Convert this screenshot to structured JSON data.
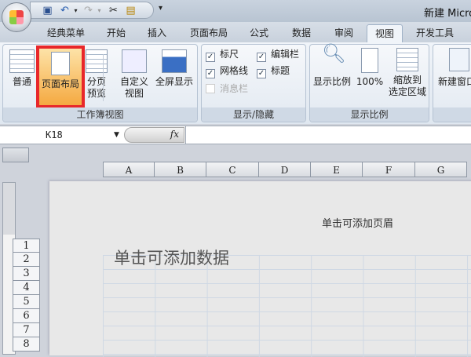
{
  "window": {
    "title": "新建 Micro"
  },
  "tabs": [
    "经典菜单",
    "开始",
    "插入",
    "页面布局",
    "公式",
    "数据",
    "审阅",
    "视图",
    "开发工具"
  ],
  "active_tab": "视图",
  "ribbon": {
    "workbook_views": {
      "label": "工作簿视图",
      "buttons": [
        "普通",
        "页面布局",
        "分页\n预览",
        "自定义\n视图",
        "全屏显示"
      ],
      "selected": "页面布局"
    },
    "show_hide": {
      "label": "显示/隐藏",
      "checks": [
        {
          "label": "标尺",
          "checked": true
        },
        {
          "label": "编辑栏",
          "checked": true
        },
        {
          "label": "网格线",
          "checked": true
        },
        {
          "label": "标题",
          "checked": true
        },
        {
          "label": "消息栏",
          "checked": false,
          "disabled": true
        }
      ]
    },
    "zoom": {
      "label": "显示比例",
      "buttons": [
        "显示比例",
        "100%",
        "缩放到\n选定区域"
      ]
    },
    "window_group": {
      "buttons": [
        "新建窗口"
      ]
    }
  },
  "formula_bar": {
    "name_box": "K18",
    "fx": "fx",
    "value": ""
  },
  "columns": [
    "A",
    "B",
    "C",
    "D",
    "E",
    "F",
    "G"
  ],
  "rows": [
    "1",
    "2",
    "3",
    "4",
    "5",
    "6",
    "7",
    "8"
  ],
  "page": {
    "header_placeholder": "单击可添加页眉",
    "data_placeholder": "单击可添加数据"
  },
  "colors": {
    "highlight": "#e8272a",
    "selected_button": "#f5a941"
  }
}
